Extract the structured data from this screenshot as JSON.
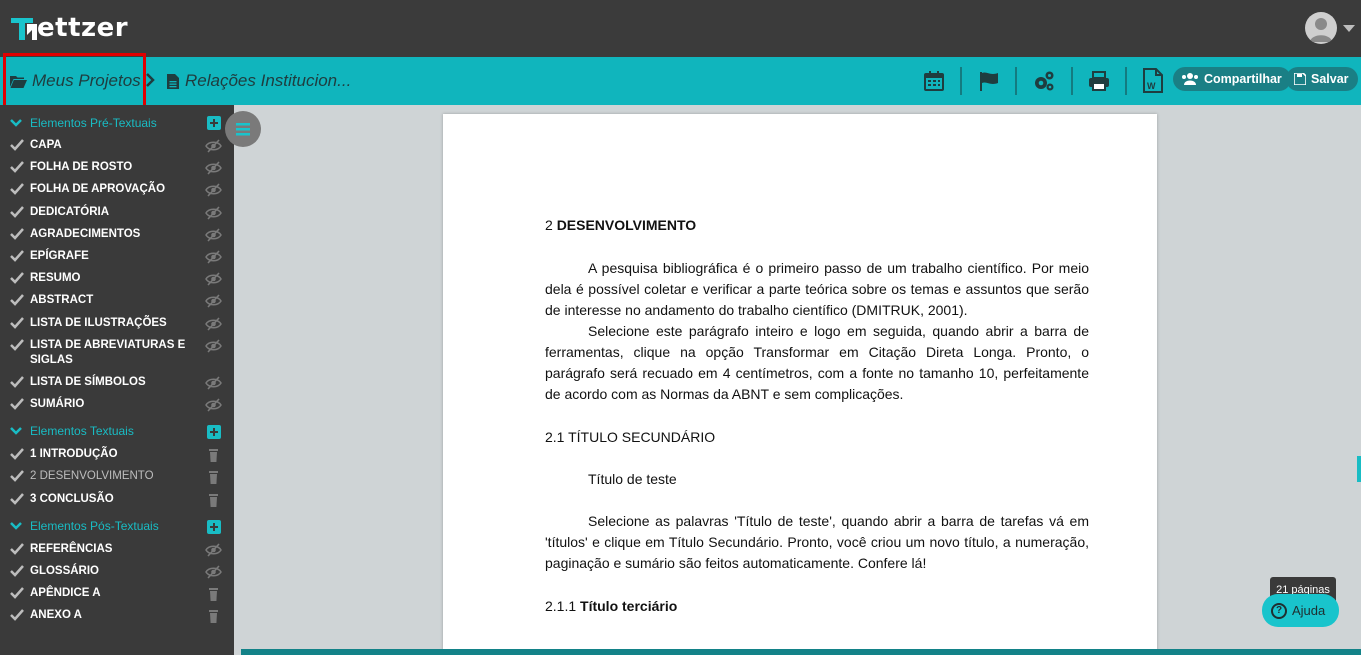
{
  "app": {
    "name": "ettzer",
    "brand_color": "#10b5bd"
  },
  "breadcrumb": {
    "home": "Meus Projetos",
    "document": "Relações Institucion..."
  },
  "toolbar": {
    "icons": [
      "calendar-icon",
      "flag-icon",
      "settings-icon",
      "print-icon",
      "word-export-icon"
    ],
    "share_label": "Compartilhar",
    "save_label": "Salvar"
  },
  "sidebar": {
    "pre_textual": {
      "title": "Elementos Pré-Textuais",
      "items": [
        "CAPA",
        "FOLHA DE ROSTO",
        "FOLHA DE APROVAÇÃO",
        "DEDICATÓRIA",
        "AGRADECIMENTOS",
        "EPÍGRAFE",
        "RESUMO",
        "ABSTRACT",
        "LISTA DE ILUSTRAÇÕES",
        "LISTA DE ABREVIATURAS E SIGLAS",
        "LISTA DE SÍMBOLOS",
        "SUMÁRIO"
      ]
    },
    "textual": {
      "title": "Elementos Textuais",
      "items": [
        {
          "num": "1",
          "label": "INTRODUÇÃO"
        },
        {
          "num": "2",
          "label": "DESENVOLVIMENTO"
        },
        {
          "num": "3",
          "label": "CONCLUSÃO"
        }
      ]
    },
    "post_textual": {
      "title": "Elementos Pós-Textuais",
      "items": [
        "REFERÊNCIAS",
        "GLOSSÁRIO",
        "APÊNDICE A",
        "ANEXO A"
      ]
    }
  },
  "document": {
    "heading_num": "2",
    "heading": "DESENVOLVIMENTO",
    "p1": "A pesquisa bibliográfica é o primeiro passo de um trabalho científico. Por meio dela é possível coletar e verificar a parte teórica sobre os temas e assuntos que serão de interesse no andamento do trabalho científico (DMITRUK, 2001).",
    "p2": "Selecione este parágrafo inteiro e logo em seguida, quando abrir a barra de ferramentas, clique na opção Transformar em Citação Direta Longa. Pronto, o parágrafo será recuado em 4 centímetros, com a fonte no tamanho 10, perfeitamente de acordo com as Normas da ABNT e sem complicações.",
    "h2": "2.1 TÍTULO SECUNDÁRIO",
    "p3": "Título de teste",
    "p4": "Selecione as palavras 'Título de teste', quando abrir a barra de tarefas vá em 'títulos' e clique em Título Secundário. Pronto, você criou um novo título, a numeração, paginação e sumário são feitos automaticamente. Confere lá!",
    "h3_num": "2.1.1",
    "h3": "Título terciário"
  },
  "status": {
    "pages": "21 páginas",
    "help_label": "Ajuda"
  }
}
